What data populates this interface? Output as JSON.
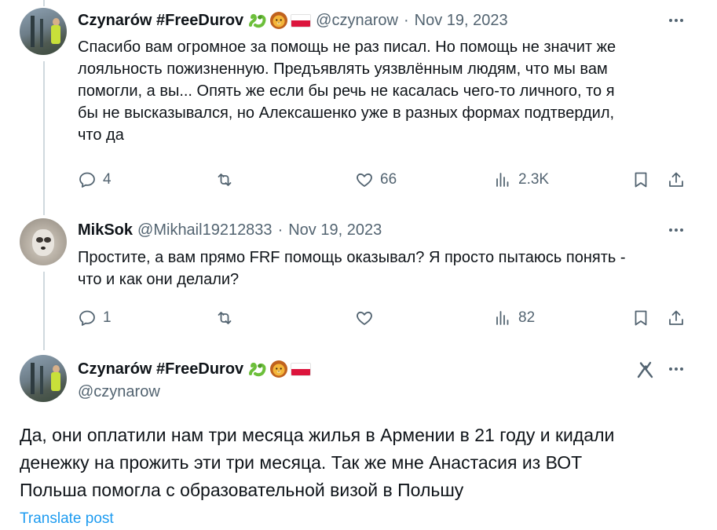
{
  "tweets": [
    {
      "name": "Czynarów #FreeDurov",
      "emojis": [
        "snake-emoji",
        "lion-emoji",
        "poland-flag-emoji"
      ],
      "handle": "@czynarow",
      "separator": "·",
      "date": "Nov 19, 2023",
      "lines": [
        "Спасибо вам огромное за помощь не раз писал. Но помощь не значит же",
        "лояльность пожизненную. Предъявлять уязвлённым людям, что мы вам",
        "помогли, а вы... Опять же если бы речь не касалась чего-то личного, то я",
        "бы не высказывался, но Алексашенко уже в разных формах подтвердил,",
        "что да"
      ],
      "replies": "4",
      "reposts": "",
      "likes": "66",
      "views": "2.3K"
    },
    {
      "name": "MikSok",
      "handle": "@Mikhail19212833",
      "separator": "·",
      "date": "Nov 19, 2023",
      "lines": [
        "Простите, а вам прямо FRF помощь оказывал? Я просто пытаюсь понять -",
        "что и как они делали?"
      ],
      "replies": "1",
      "reposts": "",
      "likes": "",
      "views": "82"
    }
  ],
  "main_tweet": {
    "name": "Czynarów #FreeDurov",
    "emojis": [
      "snake-emoji",
      "lion-emoji",
      "poland-flag-emoji"
    ],
    "handle": "@czynarow",
    "lines": [
      "Да, они оплатили нам три месяца жилья в Армении в 21 году и кидали",
      "денежку на прожить эти три месяца. Так же мне Анастасия из ВОТ",
      "Польша помогла с образовательной визой в Польшу"
    ],
    "translate_label": "Translate post"
  },
  "icons": [
    "reply-icon",
    "repost-icon",
    "like-icon",
    "views-icon",
    "bookmark-icon",
    "share-icon",
    "more-icon",
    "grok-icon"
  ],
  "colors": {
    "text": "#0f1419",
    "secondary": "#536471",
    "link": "#1d9bf0",
    "thread_line": "#cfd9de"
  }
}
